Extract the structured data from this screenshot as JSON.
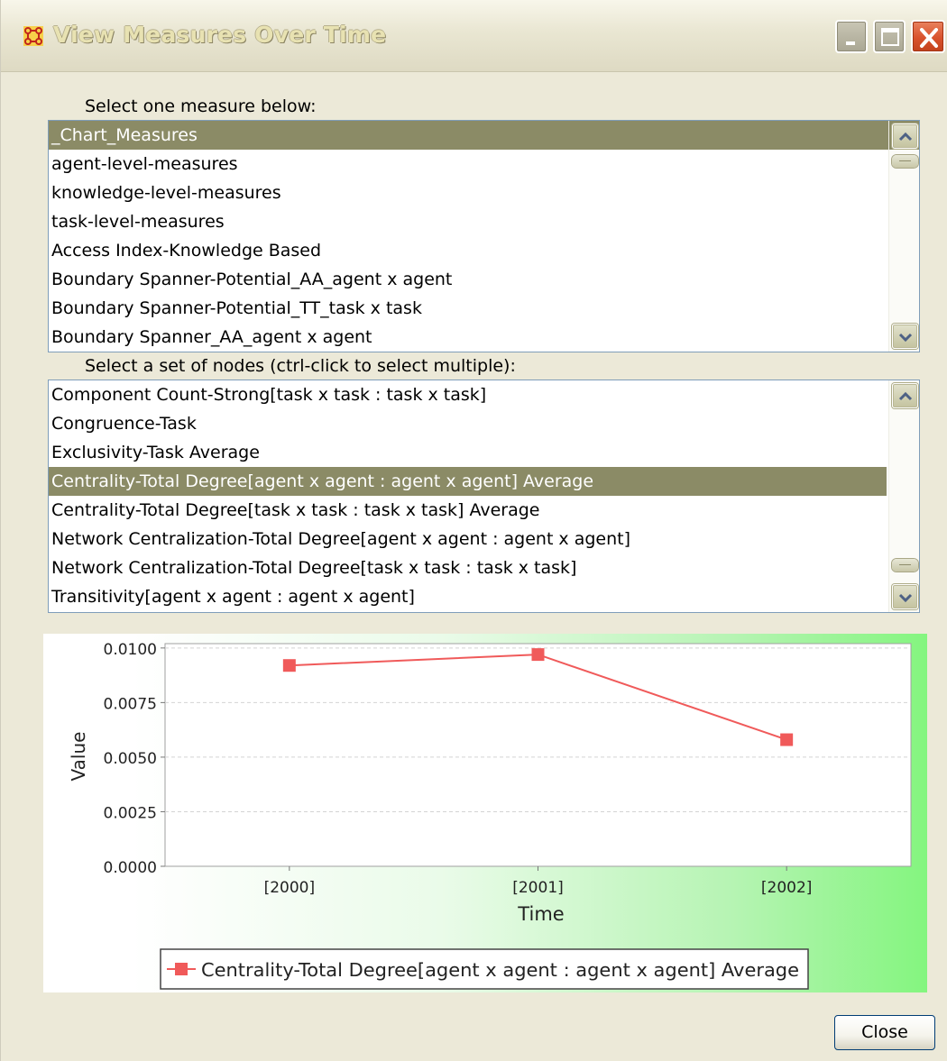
{
  "window": {
    "title": "View Measures Over Time"
  },
  "measures": {
    "label": "Select one measure below:",
    "items": [
      "_Chart_Measures",
      "agent-level-measures",
      "knowledge-level-measures",
      "task-level-measures",
      "Access Index-Knowledge Based",
      "Boundary Spanner-Potential_AA_agent x agent",
      "Boundary Spanner-Potential_TT_task x task",
      "Boundary Spanner_AA_agent x agent"
    ],
    "selected": "_Chart_Measures"
  },
  "nodes": {
    "label": "Select a set of nodes (ctrl-click to select multiple):",
    "items": [
      "Component Count-Strong[task x task : task x task]",
      "Congruence-Task",
      "Exclusivity-Task Average",
      "Centrality-Total Degree[agent x agent : agent x agent] Average",
      "Centrality-Total Degree[task x task : task x task] Average",
      "Network Centralization-Total Degree[agent x agent : agent x agent]",
      "Network Centralization-Total Degree[task x task : task x task]",
      "Transitivity[agent x agent : agent x agent]"
    ],
    "selected": "Centrality-Total Degree[agent x agent : agent x agent] Average"
  },
  "chart_data": {
    "type": "line",
    "categories": [
      "[2000]",
      "[2001]",
      "[2002]"
    ],
    "series": [
      {
        "name": "Centrality-Total Degree[agent x agent : agent x agent] Average",
        "values": [
          0.0092,
          0.0097,
          0.0058
        ],
        "color": "#f05a5a"
      }
    ],
    "xlabel": "Time",
    "ylabel": "Value",
    "ylim": [
      0,
      0.0102
    ],
    "yticks": [
      "0.0000",
      "0.0025",
      "0.0050",
      "0.0075",
      "0.0100"
    ],
    "ytick_values": [
      0,
      0.0025,
      0.005,
      0.0075,
      0.01
    ],
    "grid": true,
    "legend": "bottom"
  },
  "buttons": {
    "close": "Close"
  },
  "colors": {
    "selection": "#8b8b66",
    "series": "#f05a5a",
    "window_bg": "#ece9d8"
  }
}
